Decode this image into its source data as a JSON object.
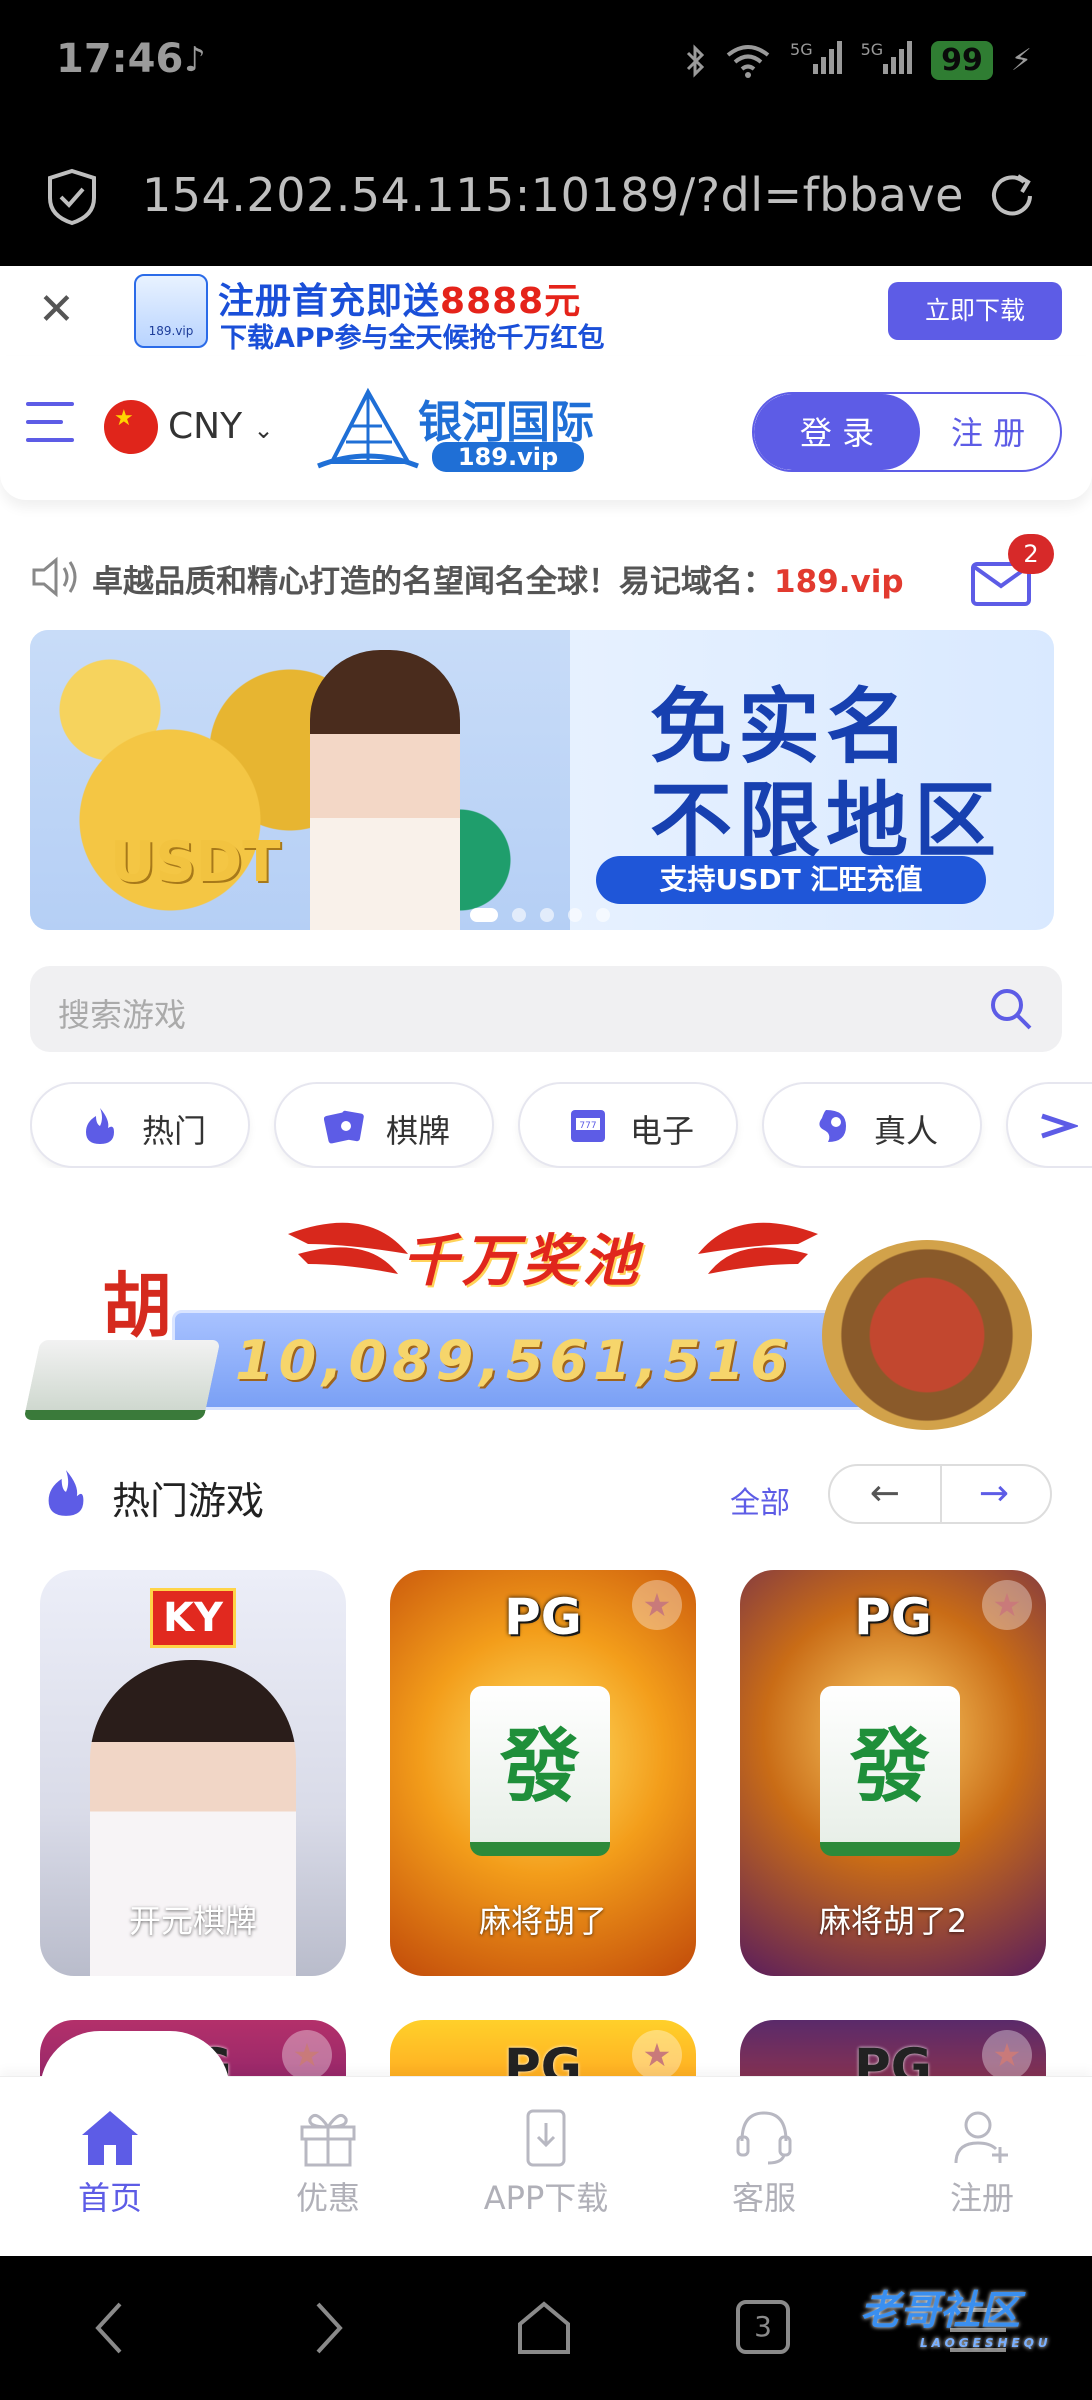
{
  "status_bar": {
    "time": "17:46",
    "network": "5G",
    "network2": "5G",
    "battery": "99"
  },
  "browser": {
    "url": "154.202.54.115:10189/?dl=fbbave"
  },
  "promo": {
    "line1_prefix": "注册首充即送",
    "line1_amount": "8888元",
    "line2": "下载APP参与全天候抢千万红包",
    "app_logo_text": "189.vip",
    "download_label": "立即下载"
  },
  "header": {
    "currency": "CNY",
    "brand_cn": "银河国际",
    "brand_domain": "189.vip",
    "login_label": "登 录",
    "register_label": "注 册"
  },
  "notice": {
    "text": "卓越品质和精心打造的名望闻名全球！易记域名：",
    "domain": "189.vip",
    "mail_count": "2"
  },
  "banner": {
    "headline1": "免实名",
    "headline2": "不限地区",
    "pill": "支持USDT 汇旺充值",
    "art_text": "USDT"
  },
  "search": {
    "placeholder": "搜索游戏"
  },
  "categories": [
    {
      "label": "热门",
      "icon": "fire-icon"
    },
    {
      "label": "棋牌",
      "icon": "cards-icon"
    },
    {
      "label": "电子",
      "icon": "slot-machine-icon"
    },
    {
      "label": "真人",
      "icon": "live-dealer-icon"
    }
  ],
  "jackpot": {
    "title": "千万奖池",
    "amount": "10,089,561,516",
    "tile_char": "胡"
  },
  "hot_games": {
    "title": "热门游戏",
    "all_label": "全部",
    "prev": "←",
    "next": "→",
    "items": [
      {
        "provider": "KY",
        "name": "开元棋牌"
      },
      {
        "provider": "PG",
        "name": "麻将胡了",
        "tile": "發"
      },
      {
        "provider": "PG",
        "name": "麻将胡了2",
        "tile": "發"
      }
    ],
    "row2_providers": [
      "PG",
      "PG",
      "PG"
    ]
  },
  "bottom_nav": [
    {
      "label": "首页",
      "active": true
    },
    {
      "label": "优惠",
      "active": false
    },
    {
      "label": "APP下载",
      "active": false
    },
    {
      "label": "客服",
      "active": false
    },
    {
      "label": "注册",
      "active": false
    }
  ],
  "system_nav": {
    "tabs_count": "3",
    "watermark": "老哥社区",
    "watermark_sub": "LAOGESHEQU"
  },
  "colors": {
    "accent": "#5d5ce6",
    "highlight": "#e23a2f",
    "brand_blue": "#1f6fd6"
  }
}
